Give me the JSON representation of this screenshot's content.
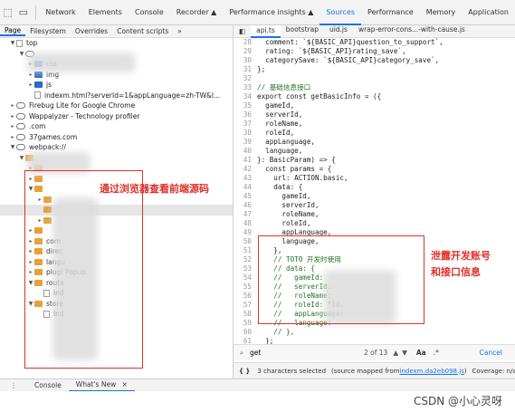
{
  "toolbar": {
    "inspect_icon": "cursor-select-icon",
    "device_icon": "device-toggle-icon",
    "tabs": [
      "Network",
      "Elements",
      "Console",
      "Recorder ▲",
      "Performance insights ▲",
      "Sources",
      "Performance",
      "Memory",
      "Application"
    ],
    "active_tab": "Sources"
  },
  "navigator": {
    "tabs": [
      "Page",
      "Filesystem",
      "Overrides",
      "Content scripts",
      "»"
    ],
    "active_tab": "Page",
    "items": [
      {
        "label": "top",
        "indent": 1,
        "icon": "file",
        "arrow": "▼"
      },
      {
        "label": "",
        "indent": 2,
        "icon": "cloud",
        "arrow": "▼"
      },
      {
        "label": "css",
        "indent": 3,
        "icon": "folder",
        "arrow": "▸"
      },
      {
        "label": "img",
        "indent": 3,
        "icon": "folder",
        "arrow": "▸"
      },
      {
        "label": "js",
        "indent": 3,
        "icon": "folder",
        "arrow": "▸"
      },
      {
        "label": "indexm.html?serverId=1&appLanguage=zh-TW&l...",
        "indent": 3,
        "icon": "file",
        "arrow": ""
      },
      {
        "label": "Firebug Lite for Google Chrome",
        "indent": 1,
        "icon": "cloud",
        "arrow": "▸"
      },
      {
        "label": "Wappalyzer - Technology profiler",
        "indent": 1,
        "icon": "cloud",
        "arrow": "▸"
      },
      {
        "label": ".com",
        "indent": 1,
        "icon": "cloud",
        "arrow": "▸"
      },
      {
        "label": "37games.com",
        "indent": 1,
        "icon": "cloud",
        "arrow": "▸"
      },
      {
        "label": "webpack://",
        "indent": 1,
        "icon": "cloud",
        "arrow": "▼"
      },
      {
        "label": "",
        "indent": 2,
        "icon": "folder",
        "arrow": "▼"
      },
      {
        "label": "",
        "indent": 3,
        "icon": "folder",
        "arrow": "▸"
      },
      {
        "label": "",
        "indent": 3,
        "icon": "folder",
        "arrow": "▸"
      },
      {
        "label": "",
        "indent": 3,
        "icon": "folder",
        "arrow": "▼"
      },
      {
        "label": "",
        "indent": 4,
        "icon": "folder",
        "arrow": "▸"
      },
      {
        "label": "",
        "indent": 4,
        "icon": "folder",
        "arrow": "",
        "selected": true
      },
      {
        "label": "",
        "indent": 4,
        "icon": "folder",
        "arrow": "▸"
      },
      {
        "label": "",
        "indent": 3,
        "icon": "folder",
        "arrow": "▸"
      },
      {
        "label": "com",
        "indent": 3,
        "icon": "folder",
        "arrow": "▸"
      },
      {
        "label": "direc",
        "indent": 3,
        "icon": "folder",
        "arrow": "▸"
      },
      {
        "label": "langu",
        "indent": 3,
        "icon": "folder",
        "arrow": "▸"
      },
      {
        "label": "plugi           Popup",
        "indent": 3,
        "icon": "folder",
        "arrow": "▸"
      },
      {
        "label": "route",
        "indent": 3,
        "icon": "folder",
        "arrow": "▼"
      },
      {
        "label": "ind",
        "indent": 4,
        "icon": "file",
        "arrow": ""
      },
      {
        "label": "store",
        "indent": 3,
        "icon": "folder",
        "arrow": "▼"
      },
      {
        "label": "ind",
        "indent": 4,
        "icon": "file",
        "arrow": ""
      }
    ]
  },
  "annotation_left": "通过浏览器查看前端源码",
  "annotation_right_1": "泄露开发账号",
  "annotation_right_2": "和接口信息",
  "editor": {
    "nav_icon": "toggle-navigator-icon",
    "file_tabs": [
      "api.ts",
      "bootstrap",
      "uid.js",
      "wrap-error-cons...-with-cause.js"
    ],
    "active_file": "api.ts",
    "lines": [
      {
        "n": "28",
        "t": "  comment: `${BASIC_API}question_to_support`,"
      },
      {
        "n": "29",
        "t": "  rating: `${BASIC_API}rating_save`,"
      },
      {
        "n": "30",
        "t": "  categorySave: `${BASIC_API}category_save`,"
      },
      {
        "n": "31",
        "t": "};"
      },
      {
        "n": "32",
        "t": ""
      },
      {
        "n": "33",
        "t": "// 基础信息接口"
      },
      {
        "n": "34",
        "t": "export const getBasicInfo = ({"
      },
      {
        "n": "35",
        "t": "  gameId,"
      },
      {
        "n": "36",
        "t": "  serverId,"
      },
      {
        "n": "37",
        "t": "  roleName,"
      },
      {
        "n": "38",
        "t": "  roleId,"
      },
      {
        "n": "39",
        "t": "  appLanguage,"
      },
      {
        "n": "40",
        "t": "  language,"
      },
      {
        "n": "41",
        "t": "}: BasicParam) => {"
      },
      {
        "n": "42",
        "t": "  const params = {"
      },
      {
        "n": "43",
        "t": "    url: ACTION.basic,"
      },
      {
        "n": "44",
        "t": "    data: {"
      },
      {
        "n": "45",
        "t": "      gameId,"
      },
      {
        "n": "46",
        "t": "      serverId,"
      },
      {
        "n": "47",
        "t": "      roleName,"
      },
      {
        "n": "48",
        "t": "      roleId,"
      },
      {
        "n": "49",
        "t": "      appLanguage,"
      },
      {
        "n": "50",
        "t": "      language,"
      },
      {
        "n": "51",
        "t": "    },"
      },
      {
        "n": "52",
        "t": "    // TOTO 开发时使用"
      },
      {
        "n": "53",
        "t": "    // data: {"
      },
      {
        "n": "54",
        "t": "    //   gameId:"
      },
      {
        "n": "55",
        "t": "    //   serverId:"
      },
      {
        "n": "56",
        "t": "    //   roleName:"
      },
      {
        "n": "57",
        "t": "    //   roleId: \"10."
      },
      {
        "n": "58",
        "t": "    //   appLanguage:"
      },
      {
        "n": "59",
        "t": "    //   language:"
      },
      {
        "n": "60",
        "t": "    // },"
      },
      {
        "n": "61",
        "t": "  };"
      }
    ]
  },
  "search": {
    "value": "get",
    "count": "2 of 13",
    "aa": "Aa",
    "regex": ".*",
    "cancel": "Cancel"
  },
  "status": {
    "braces_icon": "{ }",
    "selected": "3 characters selected",
    "mapped_prefix": "(source mapped from ",
    "mapped_link": "indexm.da2eb098.js",
    "mapped_suffix": ")",
    "coverage": "Coverage: n/a"
  },
  "drawer": {
    "menu_icon": "⋮",
    "tabs": [
      "Console",
      "What's New"
    ],
    "active_tab": "What's New",
    "close": "×"
  },
  "watermark": "CSDN @小心灵呀",
  "colors": {
    "accent": "#1a73e8",
    "annotation": "#e0302b",
    "folder": "#2a6ac9"
  }
}
